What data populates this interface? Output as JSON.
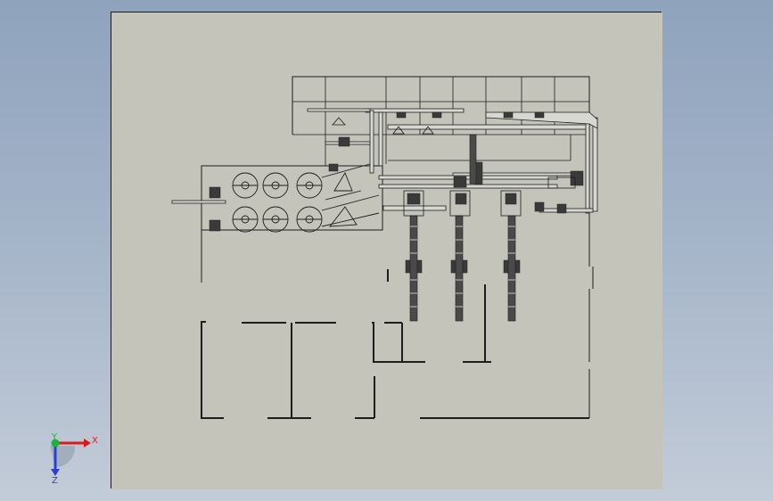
{
  "viewport": {
    "background_top": "#8fa3bd",
    "background_bottom": "#c3ccd8"
  },
  "sheet": {
    "fill": "#c4c4bb",
    "border": "#1a1a1a"
  },
  "drawing": {
    "line_color": "#1e1e1e",
    "equipment_color": "#3a3a3a",
    "duct_color": "#d8d8d2"
  },
  "triad": {
    "x_label": "X",
    "y_label": "Y",
    "z_label": "Z",
    "x_color": "#d81b1b",
    "y_color": "#19b33a",
    "z_color": "#2b3fd1"
  }
}
